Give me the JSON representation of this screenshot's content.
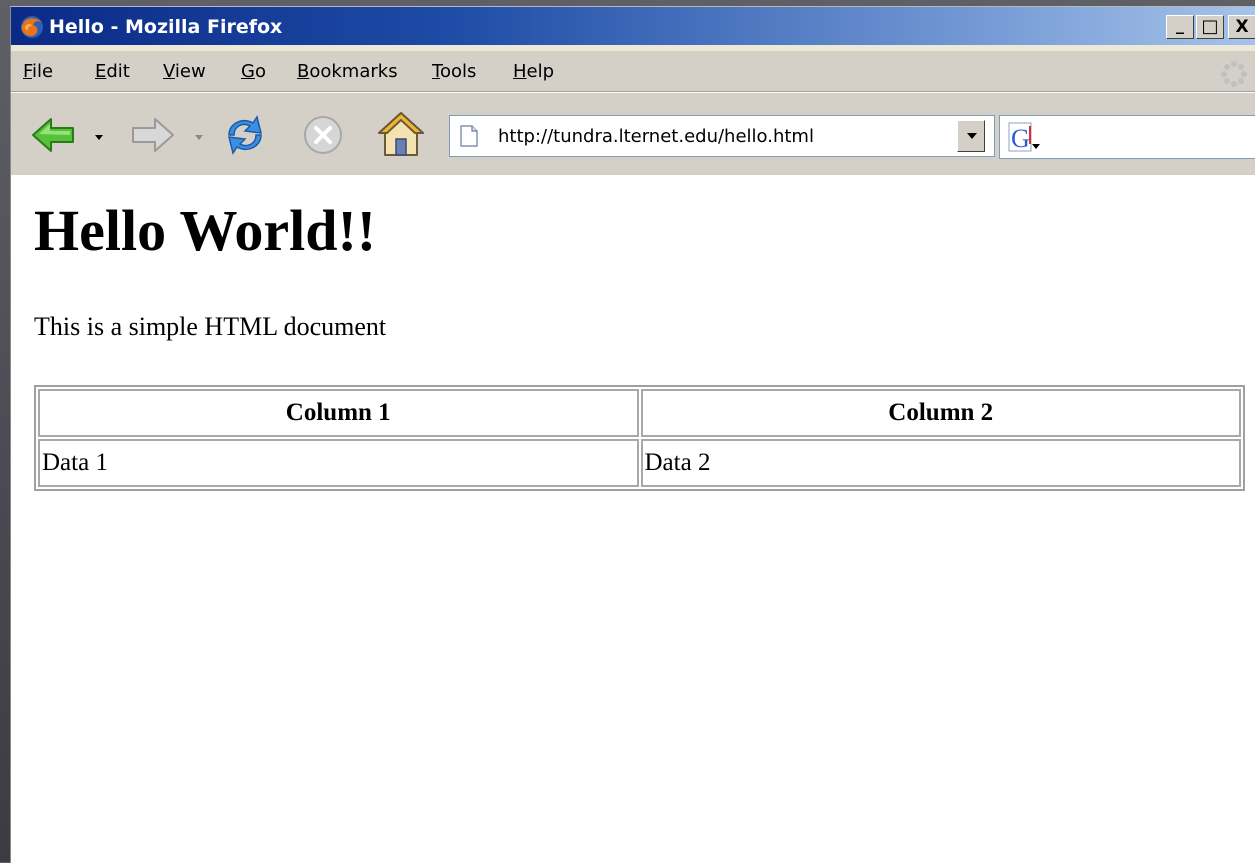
{
  "window": {
    "title": "Hello - Mozilla Firefox",
    "controls": {
      "minimize": "_",
      "maximize": "□",
      "close": "X"
    }
  },
  "menubar": {
    "items": [
      {
        "accel": "F",
        "rest": "ile"
      },
      {
        "accel": "E",
        "rest": "dit"
      },
      {
        "accel": "V",
        "rest": "iew"
      },
      {
        "accel": "G",
        "rest": "o"
      },
      {
        "accel": "B",
        "rest": "ookmarks"
      },
      {
        "accel": "T",
        "rest": "ools"
      },
      {
        "accel": "H",
        "rest": "elp"
      }
    ]
  },
  "toolbar": {
    "icons": [
      "back-icon",
      "forward-icon",
      "reload-icon",
      "stop-icon",
      "home-icon"
    ],
    "url": "http://tundra.lternet.edu/hello.html",
    "search_engine_icon": "google-icon",
    "search_value": ""
  },
  "page": {
    "heading": "Hello World!!",
    "paragraph": "This is a simple HTML document",
    "table": {
      "headers": [
        "Column 1",
        "Column 2"
      ],
      "rows": [
        [
          "Data 1",
          "Data 2"
        ]
      ]
    }
  },
  "colors": {
    "titlebar_dark": "#0b2a87",
    "titlebar_light": "#a6c3ea",
    "chrome": "#d4d0c8",
    "content_bg": "#ffffff",
    "back_arrow": "#3ca62a",
    "reload_blue": "#2a7fd6"
  }
}
